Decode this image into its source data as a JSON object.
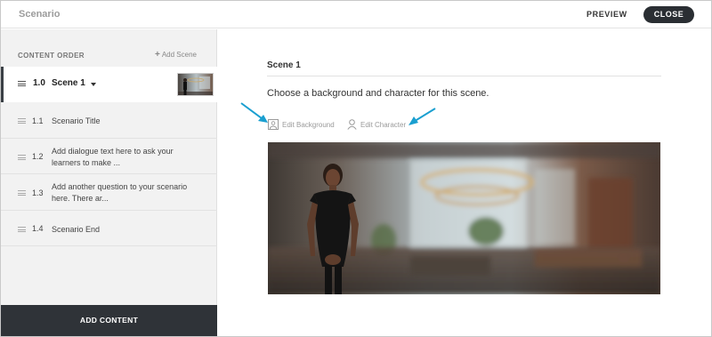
{
  "header": {
    "app_title": "Scenario",
    "preview_label": "PREVIEW",
    "close_label": "CLOSE"
  },
  "sidebar": {
    "section_title": "CONTENT ORDER",
    "add_scene_label": "Add Scene",
    "scene": {
      "number": "1.0",
      "name": "Scene 1"
    },
    "items": [
      {
        "number": "1.1",
        "text": "Scenario Title"
      },
      {
        "number": "1.2",
        "text": "Add dialogue text here to ask your learners to make ..."
      },
      {
        "number": "1.3",
        "text": "Add another question to your scenario here. There ar..."
      },
      {
        "number": "1.4",
        "text": "Scenario End"
      }
    ],
    "add_content_label": "ADD CONTENT"
  },
  "main": {
    "scene_heading": "Scene 1",
    "instruction": "Choose a background and character for this scene.",
    "edit_background_label": "Edit Background",
    "edit_character_label": "Edit Character"
  },
  "colors": {
    "accent_arrow": "#1a9fd0",
    "dark_button": "#2a2e33",
    "sidebar_bg": "#f2f2f2"
  },
  "icons": [
    "image-icon",
    "person-icon",
    "plus-icon",
    "drag-handle-icon",
    "caret-down-icon"
  ]
}
